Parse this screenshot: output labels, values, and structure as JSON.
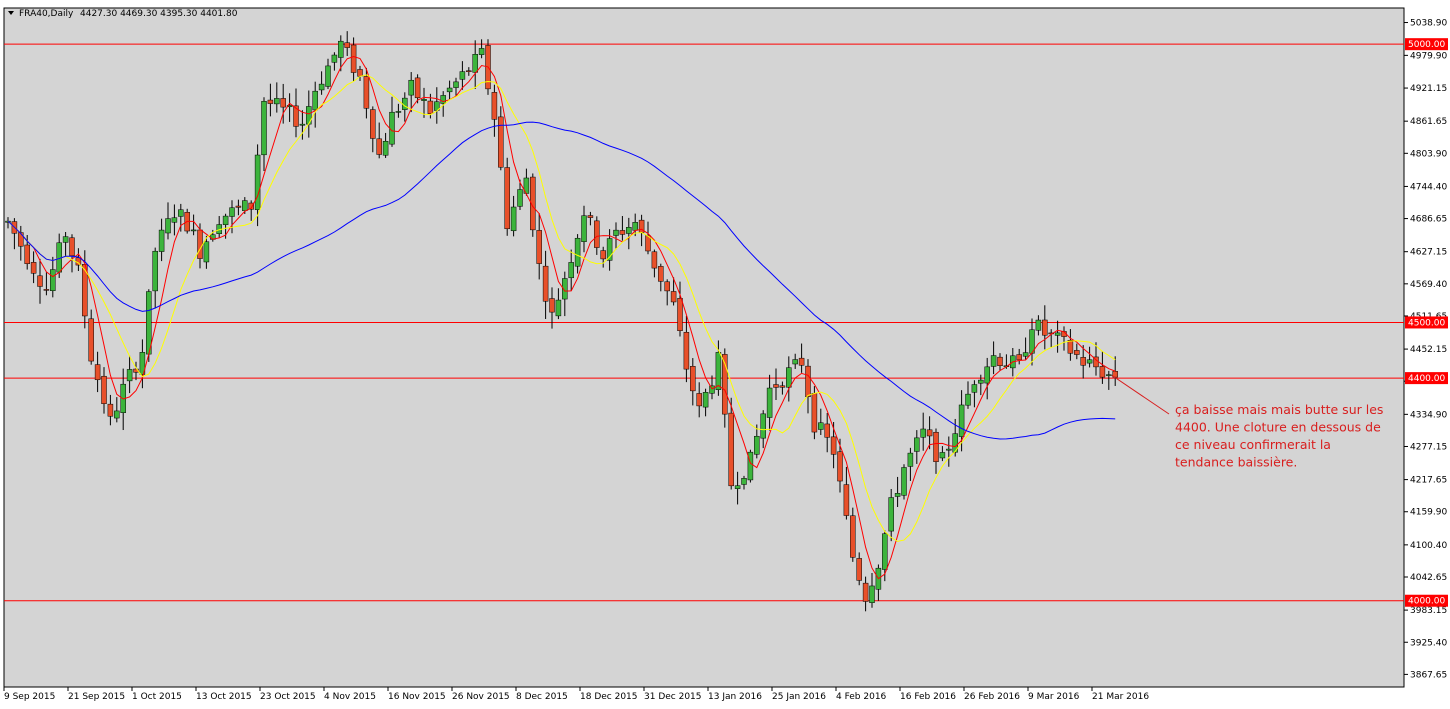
{
  "header": {
    "symbol": "FRA40,Daily",
    "ohlc": "4427.30 4469.30 4395.30 4401.80"
  },
  "colors": {
    "background": "#d4d4d4",
    "up_candle": "#3cb43c",
    "down_candle": "#e8502a",
    "wick": "#000000",
    "level_line": "#ff0000",
    "ma_fast": "#ff0000",
    "ma_mid": "#ffff00",
    "ma_slow": "#0000ff",
    "annotation": "#d81e1e"
  },
  "chart_data": {
    "type": "candlestick",
    "symbol": "FRA40",
    "timeframe": "Daily",
    "ylim": [
      3845,
      5065
    ],
    "y_ticks": [
      "5038.90",
      "4979.90",
      "4921.15",
      "4861.65",
      "4803.90",
      "4744.40",
      "4686.65",
      "4627.15",
      "4569.40",
      "4511.65",
      "4452.15",
      "4394.40",
      "4334.90",
      "4277.15",
      "4217.65",
      "4159.90",
      "4100.40",
      "4042.65",
      "3983.15",
      "3925.40",
      "3867.65"
    ],
    "x_labels": [
      {
        "label": "9 Sep 2015",
        "index": 0
      },
      {
        "label": "21 Sep 2015",
        "index": 10
      },
      {
        "label": "1 Oct 2015",
        "index": 20
      },
      {
        "label": "13 Oct 2015",
        "index": 30
      },
      {
        "label": "23 Oct 2015",
        "index": 40
      },
      {
        "label": "4 Nov 2015",
        "index": 50
      },
      {
        "label": "16 Nov 2015",
        "index": 60
      },
      {
        "label": "26 Nov 2015",
        "index": 70
      },
      {
        "label": "8 Dec 2015",
        "index": 80
      },
      {
        "label": "18 Dec 2015",
        "index": 90
      },
      {
        "label": "31 Dec 2015",
        "index": 100
      },
      {
        "label": "13 Jan 2016",
        "index": 110
      },
      {
        "label": "25 Jan 2016",
        "index": 120
      },
      {
        "label": "4 Feb 2016",
        "index": 130
      },
      {
        "label": "16 Feb 2016",
        "index": 140
      },
      {
        "label": "26 Feb 2016",
        "index": 150
      },
      {
        "label": "9 Mar 2016",
        "index": 160
      },
      {
        "label": "21 Mar 2016",
        "index": 170
      }
    ],
    "levels": [
      {
        "value": 5000,
        "label": "5000.00"
      },
      {
        "value": 4500,
        "label": "4500.00"
      },
      {
        "value": 4400,
        "label": "4400.00"
      },
      {
        "value": 4000,
        "label": "4000.00"
      }
    ],
    "anchors": [
      [
        0,
        4680
      ],
      [
        4,
        4600
      ],
      [
        6,
        4560
      ],
      [
        9,
        4660
      ],
      [
        11,
        4590
      ],
      [
        13,
        4440
      ],
      [
        16,
        4320
      ],
      [
        18,
        4380
      ],
      [
        21,
        4450
      ],
      [
        23,
        4630
      ],
      [
        26,
        4700
      ],
      [
        28,
        4680
      ],
      [
        30,
        4630
      ],
      [
        33,
        4690
      ],
      [
        38,
        4710
      ],
      [
        40,
        4900
      ],
      [
        43,
        4880
      ],
      [
        46,
        4860
      ],
      [
        48,
        4920
      ],
      [
        52,
        5000
      ],
      [
        55,
        4940
      ],
      [
        58,
        4800
      ],
      [
        60,
        4870
      ],
      [
        63,
        4920
      ],
      [
        66,
        4880
      ],
      [
        70,
        4930
      ],
      [
        74,
        4980
      ],
      [
        76,
        4870
      ],
      [
        78,
        4680
      ],
      [
        81,
        4760
      ],
      [
        83,
        4600
      ],
      [
        85,
        4510
      ],
      [
        88,
        4620
      ],
      [
        90,
        4700
      ],
      [
        93,
        4620
      ],
      [
        95,
        4660
      ],
      [
        98,
        4680
      ],
      [
        102,
        4580
      ],
      [
        104,
        4530
      ],
      [
        106,
        4420
      ],
      [
        108,
        4340
      ],
      [
        111,
        4430
      ],
      [
        113,
        4210
      ],
      [
        116,
        4250
      ],
      [
        119,
        4380
      ],
      [
        121,
        4400
      ],
      [
        124,
        4430
      ],
      [
        126,
        4320
      ],
      [
        129,
        4270
      ],
      [
        132,
        4080
      ],
      [
        134,
        4010
      ],
      [
        136,
        4070
      ],
      [
        138,
        4170
      ],
      [
        140,
        4240
      ],
      [
        143,
        4300
      ],
      [
        146,
        4250
      ],
      [
        148,
        4310
      ],
      [
        151,
        4400
      ],
      [
        154,
        4440
      ],
      [
        156,
        4430
      ],
      [
        158,
        4420
      ],
      [
        160,
        4500
      ],
      [
        162,
        4480
      ],
      [
        165,
        4460
      ],
      [
        168,
        4430
      ],
      [
        170,
        4420
      ],
      [
        172,
        4405
      ]
    ],
    "indicators": [
      {
        "type": "MA",
        "period": 5,
        "color": "#ff0000"
      },
      {
        "type": "MA",
        "period": 10,
        "color": "#ffff00"
      },
      {
        "type": "MA",
        "period": 50,
        "color": "#0000ff"
      }
    ],
    "annotation": {
      "target_index": 172,
      "target_value": 4405,
      "lines": [
        "ça baisse mais mais butte sur les",
        "4400. Une cloture en dessous de",
        "ce niveau confirmerait la",
        "tendance baissière."
      ]
    }
  }
}
